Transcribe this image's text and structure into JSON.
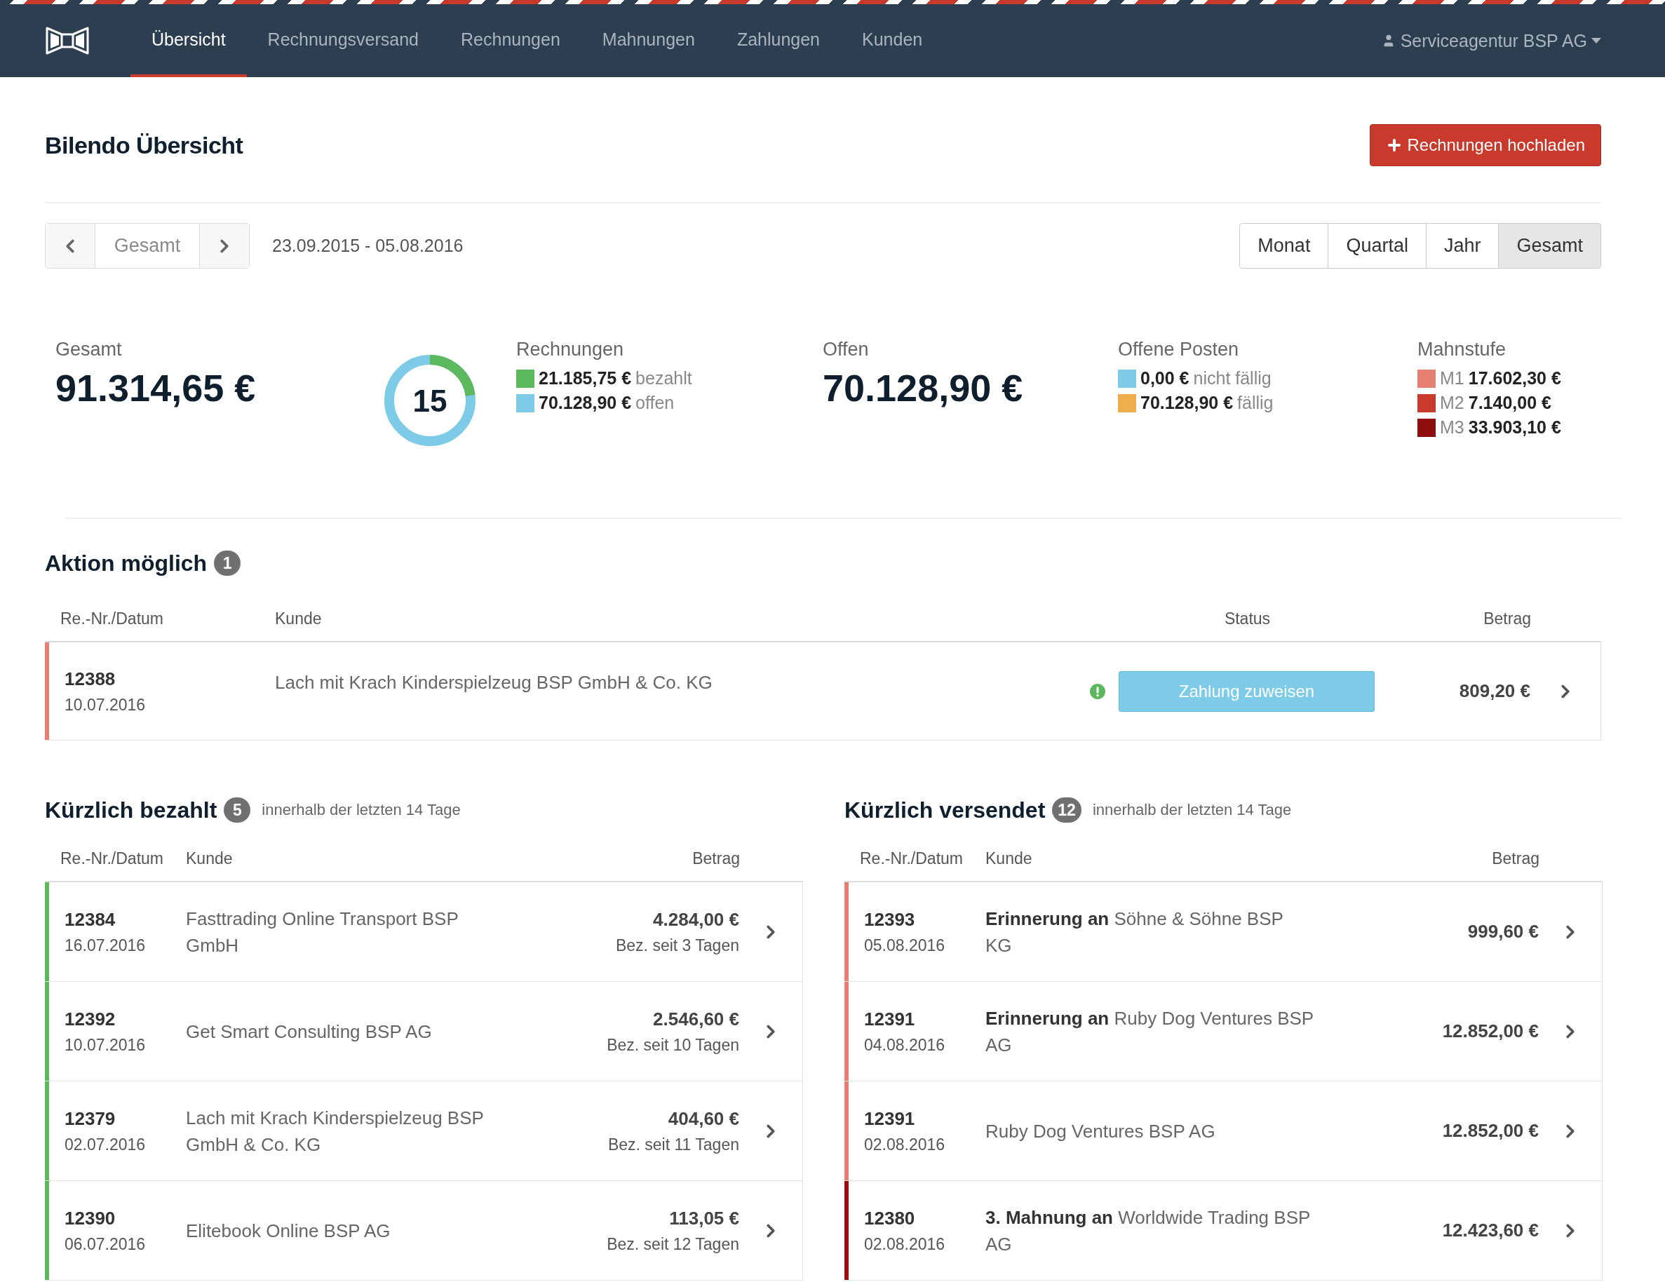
{
  "nav": {
    "items": [
      {
        "label": "Übersicht",
        "selected": true
      },
      {
        "label": "Rechnungsversand",
        "selected": false
      },
      {
        "label": "Rechnungen",
        "selected": false
      },
      {
        "label": "Mahnungen",
        "selected": false
      },
      {
        "label": "Zahlungen",
        "selected": false
      },
      {
        "label": "Kunden",
        "selected": false
      }
    ],
    "account": "Serviceagentur BSP AG"
  },
  "header": {
    "title": "Bilendo Übersicht",
    "upload_button": "Rechnungen hochladen"
  },
  "period": {
    "current": "Gesamt",
    "range": "23.09.2015 - 05.08.2016",
    "ranges": [
      {
        "label": "Monat",
        "selected": false
      },
      {
        "label": "Quartal",
        "selected": false
      },
      {
        "label": "Jahr",
        "selected": false
      },
      {
        "label": "Gesamt",
        "selected": true
      }
    ]
  },
  "stats": {
    "total": {
      "label": "Gesamt",
      "value": "91.314,65 €"
    },
    "donut": {
      "count": "15",
      "level": 0.23
    },
    "invoices": {
      "label": "Rechnungen",
      "items": [
        {
          "amount": "21.185,75 €",
          "text": "bezahlt",
          "color": "#5cb85c"
        },
        {
          "amount": "70.128,90 €",
          "text": "offen",
          "color": "#7ecbe8"
        }
      ]
    },
    "open": {
      "label": "Offen",
      "value": "70.128,90 €"
    },
    "open_items": {
      "label": "Offene Posten",
      "items": [
        {
          "amount": "0,00 €",
          "text": "nicht fällig",
          "color": "#7ecbe8"
        },
        {
          "amount": "70.128,90 €",
          "text": "fällig",
          "color": "#f0ad4e"
        }
      ]
    },
    "dunning": {
      "label": "Mahnstufe",
      "items": [
        {
          "level": "M1",
          "amount": "17.602,30 €",
          "color": "#e57f72"
        },
        {
          "level": "M2",
          "amount": "7.140,00 €",
          "color": "#c9392c"
        },
        {
          "level": "M3",
          "amount": "33.903,10 €",
          "color": "#8f0d0d"
        }
      ]
    }
  },
  "action": {
    "title": "Aktion möglich",
    "count": "1",
    "columns": [
      "Re.-Nr./Datum",
      "Kunde",
      "Status",
      "Betrag"
    ],
    "rows": [
      {
        "number": "12388",
        "date": "10.07.2016",
        "customer": "Lach mit Krach Kinderspielzeug BSP GmbH & Co. KG",
        "status": "Zahlung zuweisen",
        "amount": "809,20 €",
        "color": "#e57f72"
      }
    ]
  },
  "recent": [
    {
      "title": "Kürzlich bezahlt",
      "count": "5",
      "note": "innerhalb der letzten 14 Tage",
      "columns": [
        "Re.-Nr./Datum",
        "Kunde",
        "Betrag"
      ],
      "rows": [
        {
          "number": "12384",
          "date": "16.07.2016",
          "customer": "Fasttrading Online Transport BSP GmbH",
          "amount": "4.284,00 €",
          "since": "Bez. seit 3 Tagen",
          "color": "#5cb85c"
        },
        {
          "number": "12392",
          "date": "10.07.2016",
          "customer": "Get Smart Consulting BSP AG",
          "amount": "2.546,60 €",
          "since": "Bez. seit 10 Tagen",
          "color": "#5cb85c"
        },
        {
          "number": "12379",
          "date": "02.07.2016",
          "customer": "Lach mit Krach Kinderspielzeug BSP GmbH & Co. KG",
          "amount": "404,60 €",
          "since": "Bez. seit 11 Tagen",
          "color": "#5cb85c"
        },
        {
          "number": "12390",
          "date": "06.07.2016",
          "customer": "Elitebook Online BSP AG",
          "amount": "113,05 €",
          "since": "Bez. seit 12 Tagen",
          "color": "#5cb85c"
        }
      ]
    },
    {
      "title": "Kürzlich versendet",
      "count": "12",
      "note": "innerhalb der letzten 14 Tage",
      "columns": [
        "Re.-Nr./Datum",
        "Kunde",
        "Betrag"
      ],
      "rows": [
        {
          "number": "12393",
          "date": "05.08.2016",
          "customer": "**Erinnerung an** Söhne & Söhne BSP KG",
          "amount": "999,60 €",
          "color": "#e57f72"
        },
        {
          "number": "12391",
          "date": "04.08.2016",
          "customer": "**Erinnerung an** Ruby Dog Ventures BSP AG",
          "amount": "12.852,00 €",
          "color": "#e57f72"
        },
        {
          "number": "12391",
          "date": "02.08.2016",
          "customer": "Ruby Dog Ventures BSP AG",
          "amount": "12.852,00 €",
          "color": "#e57f72"
        },
        {
          "number": "12380",
          "date": "02.08.2016",
          "customer": "**3. Mahnung an** Worldwide Trading BSP AG",
          "amount": "12.423,60 €",
          "color": "#9b0f0f"
        }
      ]
    }
  ]
}
